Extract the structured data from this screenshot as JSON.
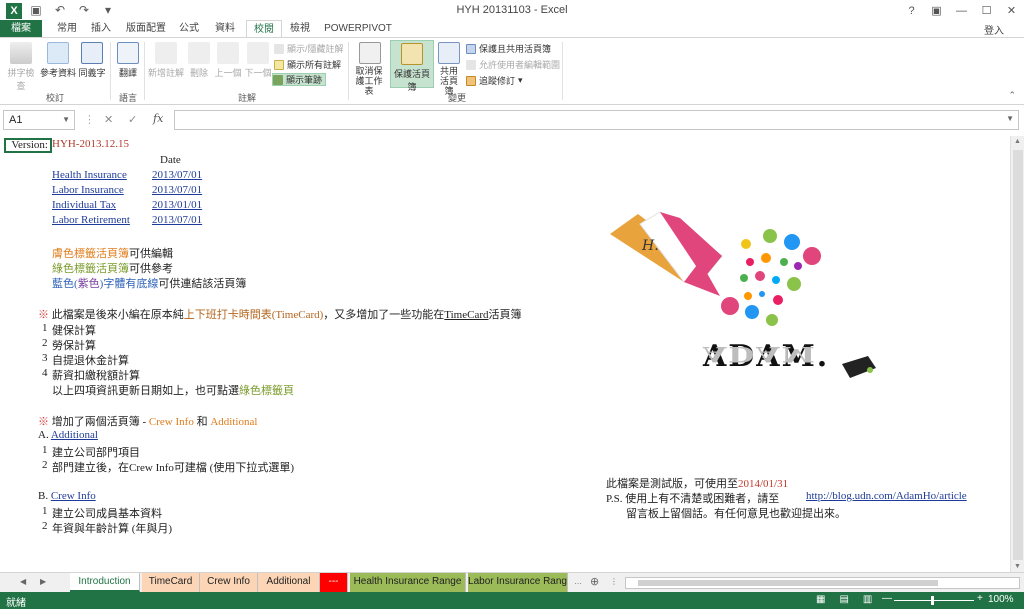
{
  "window": {
    "title": "HYH 20131103 - Excel",
    "app_icon": "X",
    "help": "?",
    "restore": "▣",
    "minimize": "—",
    "maximize": "☐",
    "close": "✕",
    "sign_in": "登入"
  },
  "ribbon_tabs": [
    "檔案",
    "常用",
    "插入",
    "版面配置",
    "公式",
    "資料",
    "校閱",
    "檢視",
    "POWERPIVOT"
  ],
  "ribbon": {
    "proofing": {
      "label": "校訂",
      "spell": "拼字檢查",
      "research": "參考資料",
      "thesaurus": "同義字"
    },
    "language": {
      "label": "語言",
      "translate": "翻譯"
    },
    "comments": {
      "label": "註解",
      "new": "新增註解",
      "delete": "刪除",
      "prev": "上一個",
      "next": "下一個",
      "show_hide": "顯示/隱藏註解",
      "show_all": "顯示所有註解",
      "show_ink": "顯示筆跡"
    },
    "changes": {
      "label": "變更",
      "unprotect_sheet": "取消保護工作表",
      "protect_workbook": "保護活頁簿",
      "share_workbook": "共用活頁簿",
      "protect_share": "保護且共用活頁簿",
      "allow_edit": "允許使用者編輯範圍",
      "track_changes": "追蹤修訂"
    }
  },
  "formula_bar": {
    "name_box": "A1",
    "cancel": "✕",
    "enter": "✓",
    "fx": "fx",
    "value": ""
  },
  "sheet": {
    "version_label": "Version:",
    "version_value": "HYH-2013.12.15",
    "date_header": "Date",
    "items": [
      {
        "name": "Health Insurance",
        "date": "2013/07/01"
      },
      {
        "name": "Labor Insurance",
        "date": "2013/07/01"
      },
      {
        "name": "Individual Tax",
        "date": "2013/01/01"
      },
      {
        "name": "Labor Retirement",
        "date": "2013/07/01"
      }
    ],
    "legend": {
      "orange_part": "膚色標籤活頁簿",
      "orange_rest": "可供編輯",
      "green_part": "綠色標籤活頁簿",
      "green_rest": "可供參考",
      "blue_part1": "藍色(",
      "purple_part": "紫色",
      "blue_part2": ")字體有底線",
      "blue_rest": "可供連結該活頁簿"
    },
    "note1": {
      "mark": "※",
      "pre": " 此檔案是後來小編在原本純",
      "hl": "上下班打卡時間表(TimeCard)",
      "mid": "，又多增加了一些功能在",
      "link": "TimeCard",
      "post": "活頁簿"
    },
    "features": [
      {
        "no": "1",
        "text": "健保計算"
      },
      {
        "no": "2",
        "text": "勞保計算"
      },
      {
        "no": "3",
        "text": "自提退休金計算"
      },
      {
        "no": "4",
        "text": "薪資扣繳稅額計算"
      }
    ],
    "features_note_pre": "以上四項資訊更新日期如上，也可點選",
    "features_note_green": "綠色標籤頁",
    "note2": {
      "mark": "※",
      "pre": " 增加了兩個活頁簿 - ",
      "crew": "Crew Info",
      "and": " 和 ",
      "additional": "Additional"
    },
    "sectionA": {
      "label": "A.",
      "link": "Additional"
    },
    "sectionA_items": [
      {
        "no": "1",
        "text": "建立公司部門項目"
      },
      {
        "no": "2",
        "text": "部門建立後，在Crew Info可建檔 (使用下拉式選單)"
      }
    ],
    "sectionB": {
      "label": "B.",
      "link": "Crew Info"
    },
    "sectionB_items": [
      {
        "no": "1",
        "text": "建立公司成員基本資料"
      },
      {
        "no": "2",
        "text": "年資與年齡計算 (年與月)"
      }
    ],
    "trial": {
      "pre": "此檔案是測試版，可使用至",
      "date": "2014/01/31"
    },
    "ps": {
      "pre": "P.S. 使用上有不清楚或困難者，請至",
      "url": "http://blog.udn.com/AdamHo/article"
    },
    "ps2": "留言板上留個話。有任何意見也歡迎提出來。",
    "logo_text": "ADAM.",
    "logo_reflect": "ADAM",
    "logo_signature": "H."
  },
  "sheet_tabs": [
    {
      "label": "Introduction",
      "color": "#ffffff"
    },
    {
      "label": "TimeCard",
      "color": "#fbd5b5"
    },
    {
      "label": "Crew Info",
      "color": "#fbd5b5"
    },
    {
      "label": "Additional",
      "color": "#fbd5b5"
    },
    {
      "label": "---",
      "color": "#ff0000"
    },
    {
      "label": "Health Insurance Range",
      "color": "#9bbb59"
    },
    {
      "label": "Labor Insurance Rang",
      "color": "#9bbb59"
    }
  ],
  "status": {
    "ready": "就緒",
    "zoom": "100%",
    "minus": "—",
    "plus": "+"
  },
  "colors": {
    "excel_green": "#217346"
  }
}
